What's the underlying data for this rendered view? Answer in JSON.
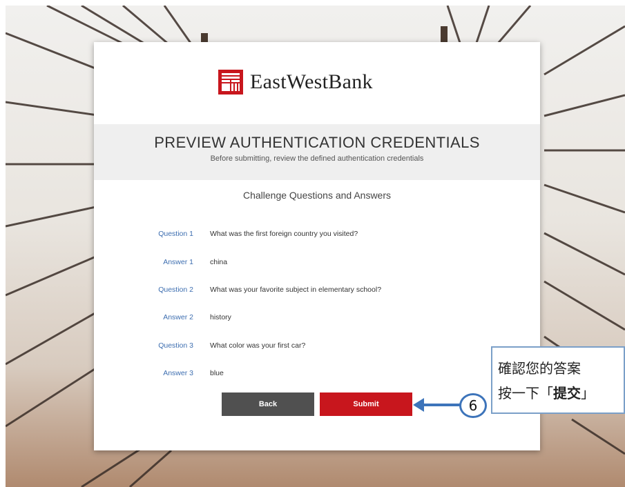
{
  "brand": {
    "name": "EastWestBank",
    "accent": "#c8161d"
  },
  "header": {
    "title": "PREVIEW AUTHENTICATION CREDENTIALS",
    "subtitle": "Before submitting, review the defined authentication credentials"
  },
  "section_title": "Challenge Questions and Answers",
  "qa": [
    {
      "label": "Question 1",
      "text": "What was the first foreign country you visited?"
    },
    {
      "label": "Answer 1",
      "text": "china"
    },
    {
      "label": "Question 2",
      "text": "What was your favorite subject in elementary school?"
    },
    {
      "label": "Answer 2",
      "text": "history"
    },
    {
      "label": "Question 3",
      "text": "What color was your first car?"
    },
    {
      "label": "Answer 3",
      "text": "blue"
    }
  ],
  "buttons": {
    "back": "Back",
    "submit": "Submit"
  },
  "annotation": {
    "step": "6",
    "line1": "確認您的答案",
    "line2_prefix": "按一下「",
    "line2_bold": "提交",
    "line2_suffix": "」",
    "color": "#3d74ba"
  }
}
